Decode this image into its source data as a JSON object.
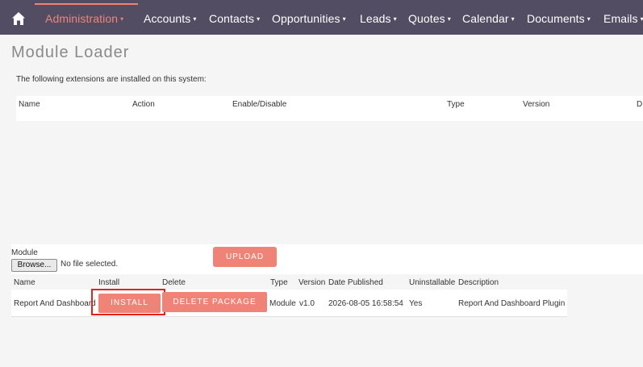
{
  "nav": {
    "items": [
      {
        "label": "Administration",
        "active": true
      },
      {
        "label": "Accounts"
      },
      {
        "label": "Contacts"
      },
      {
        "label": "Opportunities"
      },
      {
        "label": "Leads"
      },
      {
        "label": "Quotes"
      },
      {
        "label": "Calendar"
      },
      {
        "label": "Documents"
      },
      {
        "label": "Emails"
      }
    ],
    "caret": "▾",
    "accent_color": "#f08377",
    "bar_color": "#534d64"
  },
  "page": {
    "title": "Module Loader",
    "intro": "The following extensions are installed on this system:"
  },
  "installed_table": {
    "headers": [
      "Name",
      "Action",
      "Enable/Disable",
      "Type",
      "Version",
      "D"
    ]
  },
  "upload": {
    "module_label": "Module",
    "browse_label": "Browse...",
    "no_file_text": "No file selected.",
    "upload_label": "UPLOAD"
  },
  "packages_table": {
    "headers": [
      "Name",
      "Install",
      "Delete",
      "Type",
      "Version",
      "Date Published",
      "Uninstallable",
      "Description"
    ],
    "row": {
      "name": "Report And Dashboard",
      "install_label": "INSTALL",
      "delete_label": "DELETE PACKAGE",
      "type": "Module",
      "version": "v1.0",
      "date_published": "2026-08-05 16:58:54",
      "uninstallable": "Yes",
      "description": "Report And Dashboard Plugin"
    }
  }
}
